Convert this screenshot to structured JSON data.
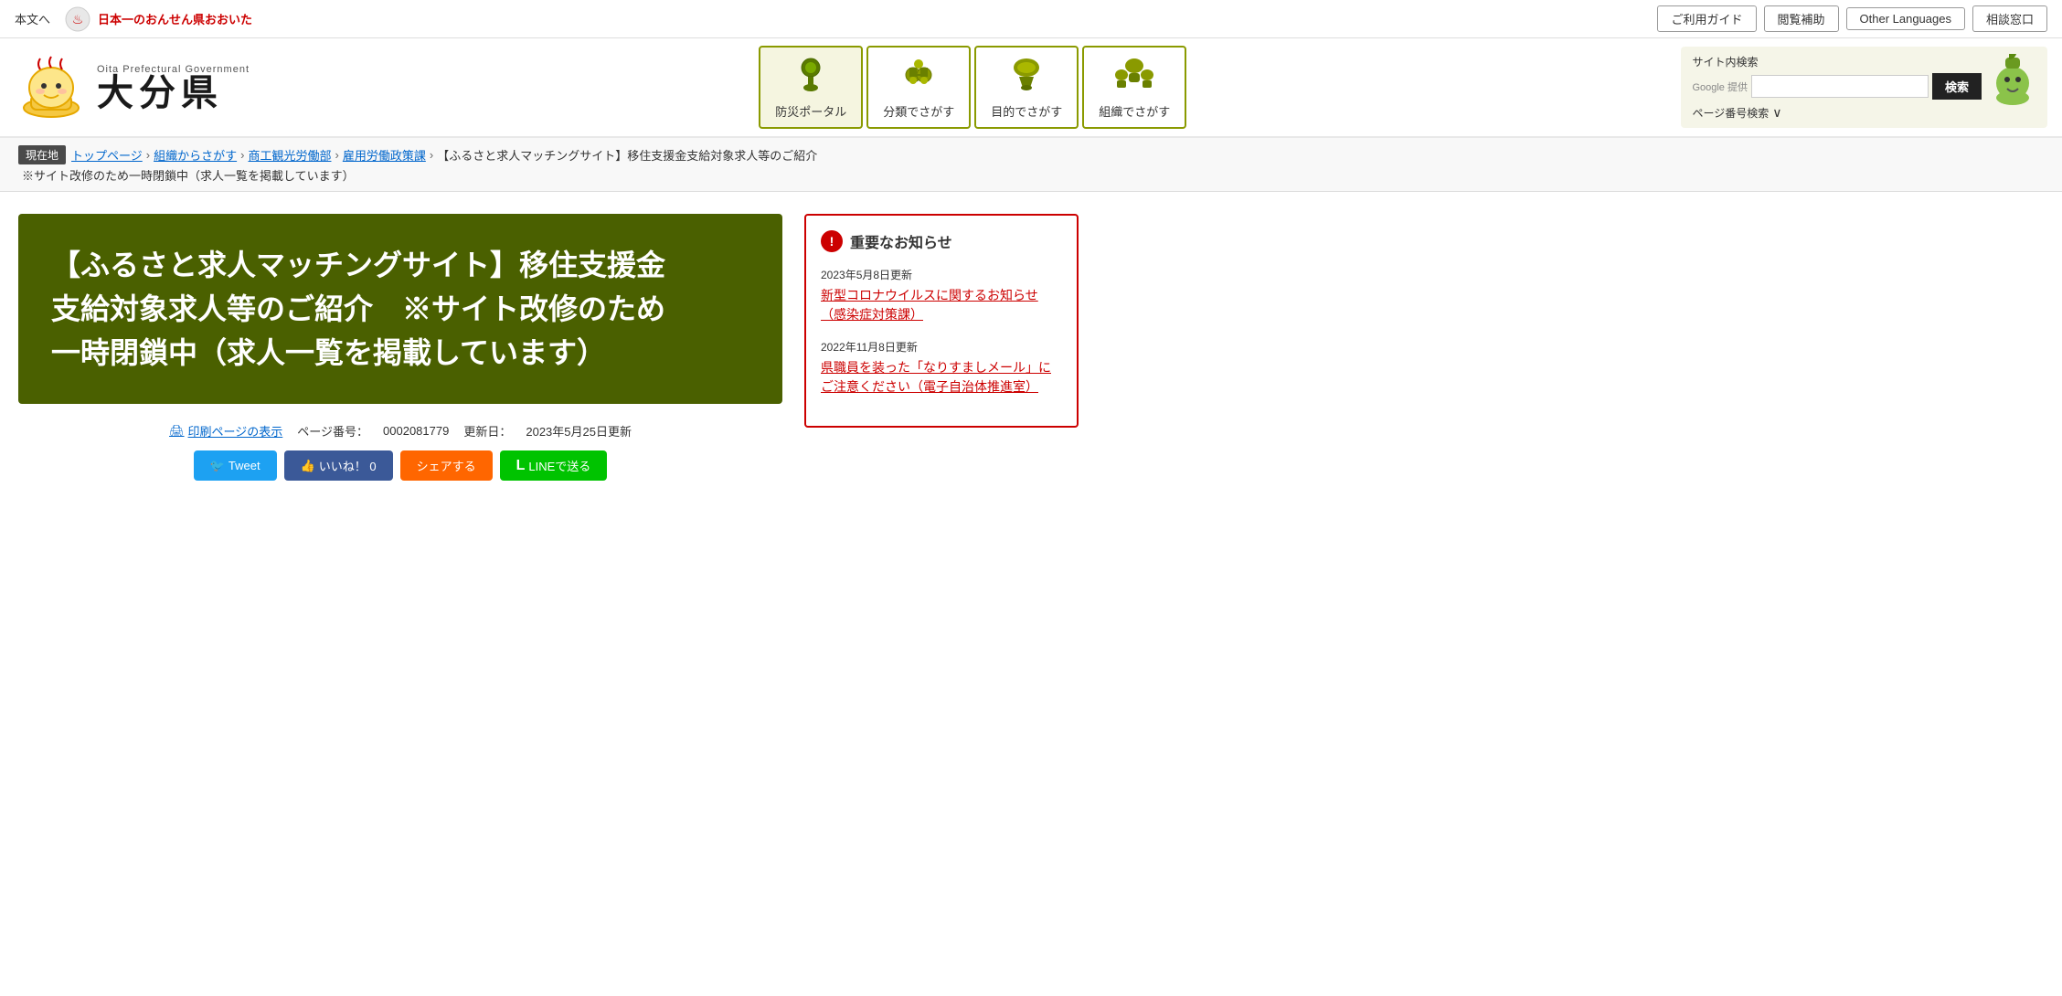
{
  "topbar": {
    "main_text": "本文へ",
    "tagline": "日本一のおんせん県おおいた",
    "util_buttons": [
      "ご利用ガイド",
      "閲覧補助",
      "Other Languages",
      "相談窓口"
    ]
  },
  "nav": {
    "items": [
      {
        "label": "防災ポータル",
        "active": true
      },
      {
        "label": "分類でさがす",
        "active": false
      },
      {
        "label": "目的でさがす",
        "active": false
      },
      {
        "label": "組織でさがす",
        "active": false
      }
    ]
  },
  "search": {
    "title": "サイト内検索",
    "google_label": "Google 提供",
    "button_label": "検索",
    "page_num_label": "ページ番号検索"
  },
  "breadcrumb": {
    "location_label": "現在地",
    "items": [
      "トップページ",
      "組織からさがす",
      "商工観光労働部",
      "雇用労働政策課"
    ],
    "current": "【ふるさと求人マッチングサイト】移住支援金支給対象求人等のご紹介",
    "note": "※サイト改修のため一時閉鎖中（求人一覧を掲載しています）"
  },
  "main": {
    "banner_title": "【ふるさと求人マッチングサイト】移住支援金\n支給対象求人等のご紹介　※サイト改修のため\n一時閉鎖中（求人一覧を掲載しています）",
    "print_label": "印刷ページの表示",
    "page_number_label": "ページ番号：",
    "page_number_value": "0002081779",
    "update_label": "更新日：",
    "update_value": "2023年5月25日更新",
    "social": {
      "tweet": "Tweet",
      "like": "いいね！ 0",
      "share": "シェアする",
      "line": "LINEで送る"
    }
  },
  "sidebar": {
    "notice_title": "重要なお知らせ",
    "items": [
      {
        "date": "2023年5月8日更新",
        "link": "新型コロナウイルスに関するお知らせ（感染症対策課）"
      },
      {
        "date": "2022年11月8日更新",
        "link": "県職員を装った「なりすましメール」にご注意ください（電子自治体推進室）"
      }
    ]
  },
  "logo": {
    "prefecture_name": "大分県",
    "gov_label": "Oita Prefectural Government"
  }
}
